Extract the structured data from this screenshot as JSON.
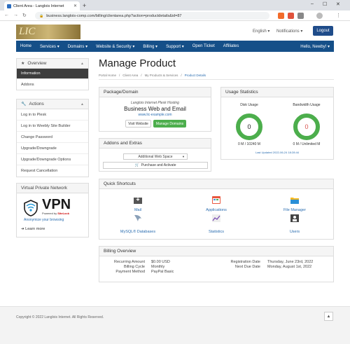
{
  "browser": {
    "tab_title": "Client Area - Langlois Internet",
    "url": "business.langlois-comp.com/billing/clientarea.php?action=productdetails&id=87"
  },
  "header": {
    "logo_monogram": "LIC",
    "language": "English",
    "notifications": "Notifications",
    "logout_label": "Logout"
  },
  "nav": {
    "items": [
      "Home",
      "Services",
      "Domains",
      "Website & Security",
      "Billing",
      "Support",
      "Open Ticket",
      "Affiliates"
    ],
    "user": "Hello, Newby!"
  },
  "sidebar": {
    "overview_title": "Overview",
    "overview_items": [
      "Information",
      "Addons"
    ],
    "actions_title": "Actions",
    "actions_items": [
      "Log in to Plesk",
      "Log in to Weebly Site Builder",
      "Change Password",
      "Upgrade/Downgrade",
      "Upgrade/Downgrade Options",
      "Request Cancellation"
    ],
    "vpn_title": "Virtual Private Network",
    "vpn_word": "VPN",
    "vpn_powered": "Powered by",
    "vpn_brand": "SiteLock",
    "vpn_tagline": "Anonymize your browsing",
    "learn_more": "Learn more"
  },
  "page": {
    "title": "Manage Product",
    "breadcrumb": [
      "Portal Home",
      "/",
      "Client Area",
      "/",
      "My Products & Services",
      "/",
      "Product Details"
    ]
  },
  "package": {
    "heading": "Package/Domain",
    "group": "Langlois Internet Plesk Hosting",
    "product": "Business Web and Email",
    "domain": "www.lic-example.com",
    "visit_label": "Visit Website",
    "manage_label": "Manage Domains"
  },
  "usage": {
    "heading": "Usage Statistics",
    "disk_label": "Disk Usage",
    "disk_value": "0",
    "disk_text": "0 M / 10240 M",
    "bw_label": "Bandwidth Usage",
    "bw_value": "0",
    "bw_text": "0 M / Unlimited M",
    "updated": "Last Updated 2022-06-24 18:28:44"
  },
  "addons": {
    "heading": "Addons and Extras",
    "select_value": "Additional Web Space",
    "purchase_label": "Purchase and Activate"
  },
  "shortcuts": {
    "heading": "Quick Shortcuts",
    "items": [
      "Mail",
      "Applications",
      "File Manager",
      "MySQL® Databases",
      "Statistics",
      "Users"
    ]
  },
  "billing": {
    "heading": "Billing Overview",
    "recurring_label": "Recurring Amount",
    "recurring_value": "$0.00 USD",
    "cycle_label": "Billing Cycle",
    "cycle_value": "Monthly",
    "method_label": "Payment Method",
    "method_value": "PayPal Basic",
    "reg_label": "Registration Date",
    "reg_value": "Thursday, June 23rd, 2022",
    "due_label": "Next Due Date",
    "due_value": "Monday, August 1st, 2022"
  },
  "footer": {
    "copyright": "Copyright © 2022 Langlois Internet. All Rights Reserved."
  },
  "colors": {
    "nav": "#154f88",
    "green": "#4cae4c",
    "red": "#d9534f",
    "link": "#2a6db0"
  }
}
